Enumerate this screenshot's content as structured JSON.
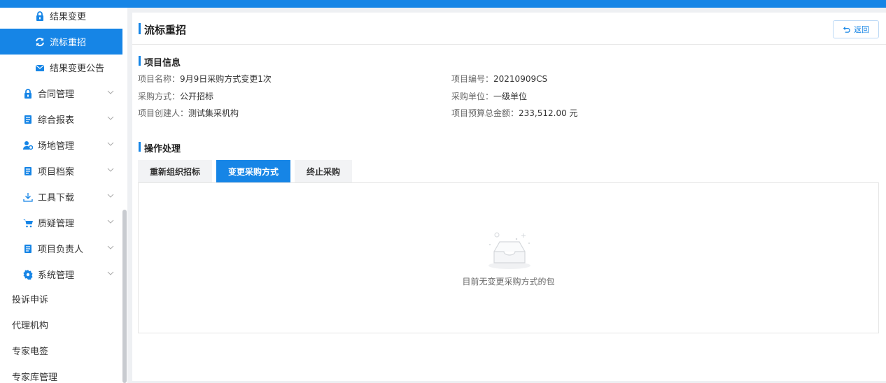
{
  "sidebar": {
    "items": [
      {
        "label": "结果变更",
        "icon": "lock-icon"
      },
      {
        "label": "流标重招",
        "icon": "refresh-icon",
        "active": true
      },
      {
        "label": "结果变更公告",
        "icon": "mail-icon"
      },
      {
        "label": "合同管理",
        "icon": "lock-icon"
      },
      {
        "label": "综合报表",
        "icon": "document-icon"
      },
      {
        "label": "场地管理",
        "icon": "user-gear-icon"
      },
      {
        "label": "项目档案",
        "icon": "document-icon"
      },
      {
        "label": "工具下载",
        "icon": "download-icon"
      },
      {
        "label": "质疑管理",
        "icon": "cart-icon"
      },
      {
        "label": "项目负责人",
        "icon": "document-icon"
      },
      {
        "label": "系统管理",
        "icon": "gear-icon"
      },
      {
        "label": "投诉申诉"
      },
      {
        "label": "代理机构"
      },
      {
        "label": "专家电签"
      },
      {
        "label": "专家库管理"
      }
    ]
  },
  "header": {
    "title": "流标重招",
    "back_label": "返回"
  },
  "project_info": {
    "title": "项目信息",
    "name_label": "项目名称：",
    "name": "9月9日采购方式变更1次",
    "code_label": "项目编号：",
    "code": "20210909CS",
    "method_label": "采购方式：",
    "method": "公开招标",
    "unit_label": "采购单位：",
    "unit": "一级单位",
    "creator_label": "项目创建人：",
    "creator": "测试集采机构",
    "budget_label": "项目预算总金额：",
    "budget": "233,512.00 元"
  },
  "operations": {
    "title": "操作处理",
    "tabs": [
      {
        "label": "重新组织招标"
      },
      {
        "label": "变更采购方式",
        "active": true
      },
      {
        "label": "终止采购"
      }
    ],
    "empty_text": "目前无变更采购方式的包"
  },
  "colors": {
    "accent": "#1685e6"
  }
}
